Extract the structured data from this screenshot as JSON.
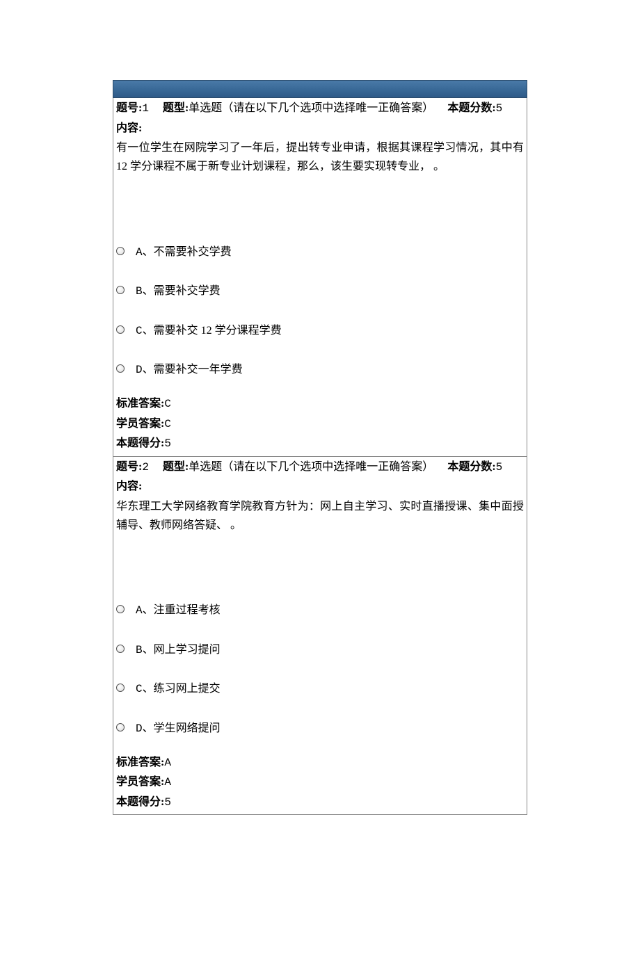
{
  "labels": {
    "question_no": "题号:",
    "question_type": "题型:",
    "question_score": "本题分数:",
    "content": "内容:",
    "correct_answer": "标准答案:",
    "student_answer": "学员答案:",
    "obtained_score": "本题得分:"
  },
  "questions": [
    {
      "number": "1",
      "type_text": "单选题（请在以下几个选项中选择唯一正确答案）",
      "score": "5",
      "content_text": "有一位学生在网院学习了一年后，提出转专业申请，根据其课程学习情况，其中有 12 学分课程不属于新专业计划课程，那么，该生要实现转专业，   。",
      "options": [
        {
          "letter": "A",
          "text": "不需要补交学费"
        },
        {
          "letter": "B",
          "text": "需要补交学费"
        },
        {
          "letter": "C",
          "text": "需要补交 12 学分课程学费"
        },
        {
          "letter": "D",
          "text": "需要补交一年学费"
        }
      ],
      "correct_answer": "C",
      "student_answer": "C",
      "obtained_score": "5"
    },
    {
      "number": "2",
      "type_text": "单选题（请在以下几个选项中选择唯一正确答案）",
      "score": "5",
      "content_text": "华东理工大学网络教育学院教育方针为：网上自主学习、实时直播授课、集中面授辅导、教师网络答疑、   。",
      "options": [
        {
          "letter": "A",
          "text": "注重过程考核"
        },
        {
          "letter": "B",
          "text": "网上学习提问"
        },
        {
          "letter": "C",
          "text": "练习网上提交"
        },
        {
          "letter": "D",
          "text": "学生网络提问"
        }
      ],
      "correct_answer": "A",
      "student_answer": "A",
      "obtained_score": "5"
    }
  ]
}
